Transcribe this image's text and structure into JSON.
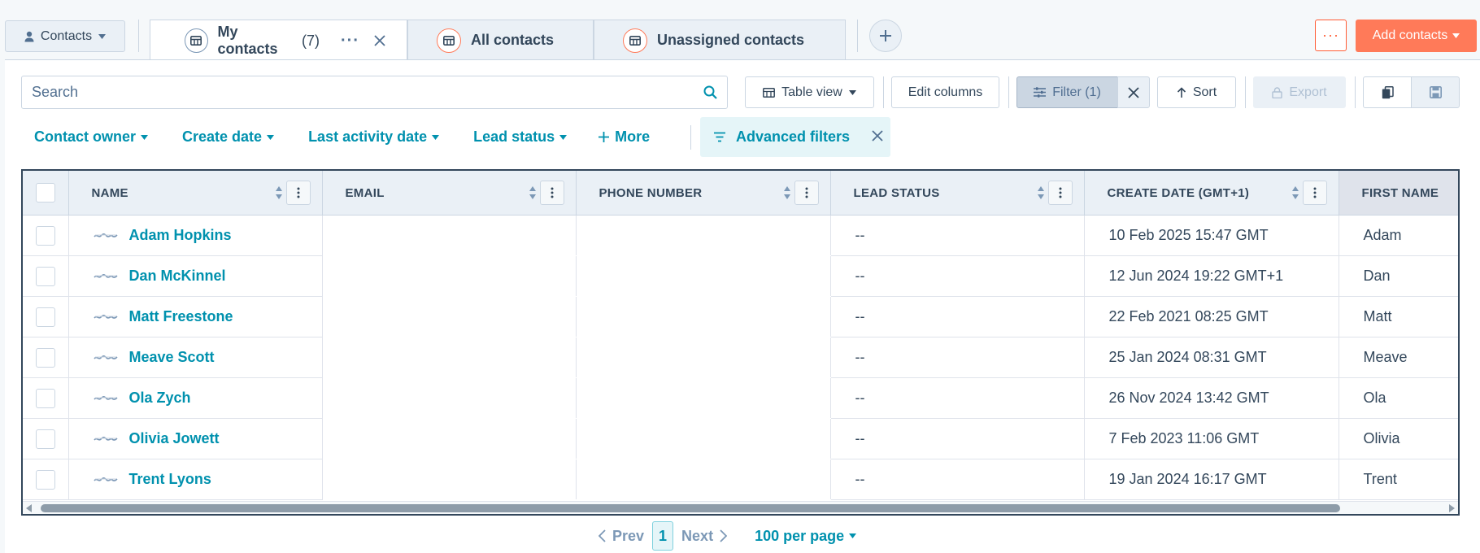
{
  "header": {
    "object_selector": "Contacts",
    "tabs": [
      {
        "label": "My contacts",
        "count": "(7)",
        "active": true
      },
      {
        "label": "All contacts",
        "active": false
      },
      {
        "label": "Unassigned contacts",
        "active": false
      }
    ],
    "more_label": "···",
    "add_contacts_label": "Add contacts"
  },
  "toolbar": {
    "search_placeholder": "Search",
    "table_view_label": "Table view",
    "edit_columns_label": "Edit columns",
    "filter_label": "Filter (1)",
    "sort_label": "Sort",
    "export_label": "Export"
  },
  "quick_filters": {
    "items": [
      "Contact owner",
      "Create date",
      "Last activity date",
      "Lead status"
    ],
    "more_label": "More",
    "advanced_label": "Advanced filters"
  },
  "table": {
    "columns": [
      "NAME",
      "EMAIL",
      "PHONE NUMBER",
      "LEAD STATUS",
      "CREATE DATE (GMT+1)",
      "FIRST NAME"
    ],
    "rows": [
      {
        "name": "Adam Hopkins",
        "email": "",
        "phone": "",
        "lead_status": "--",
        "create_date": "10 Feb 2025 15:47 GMT",
        "first_name": "Adam"
      },
      {
        "name": "Dan McKinnel",
        "email": "",
        "phone": "",
        "lead_status": "--",
        "create_date": "12 Jun 2024 19:22 GMT+1",
        "first_name": "Dan"
      },
      {
        "name": "Matt Freestone",
        "email": "",
        "phone": "",
        "lead_status": "--",
        "create_date": "22 Feb 2021 08:25 GMT",
        "first_name": "Matt"
      },
      {
        "name": "Meave Scott",
        "email": "",
        "phone": "",
        "lead_status": "--",
        "create_date": "25 Jan 2024 08:31 GMT",
        "first_name": "Meave"
      },
      {
        "name": "Ola Zych",
        "email": "",
        "phone": "",
        "lead_status": "--",
        "create_date": "26 Nov 2024 13:42 GMT",
        "first_name": "Ola"
      },
      {
        "name": "Olivia Jowett",
        "email": "",
        "phone": "",
        "lead_status": "--",
        "create_date": "7 Feb 2023 11:06 GMT",
        "first_name": "Olivia"
      },
      {
        "name": "Trent Lyons",
        "email": "",
        "phone": "",
        "lead_status": "--",
        "create_date": "19 Jan 2024 16:17 GMT",
        "first_name": "Trent"
      }
    ]
  },
  "pagination": {
    "prev_label": "Prev",
    "current_page": "1",
    "next_label": "Next",
    "per_page_label": "100 per page"
  }
}
